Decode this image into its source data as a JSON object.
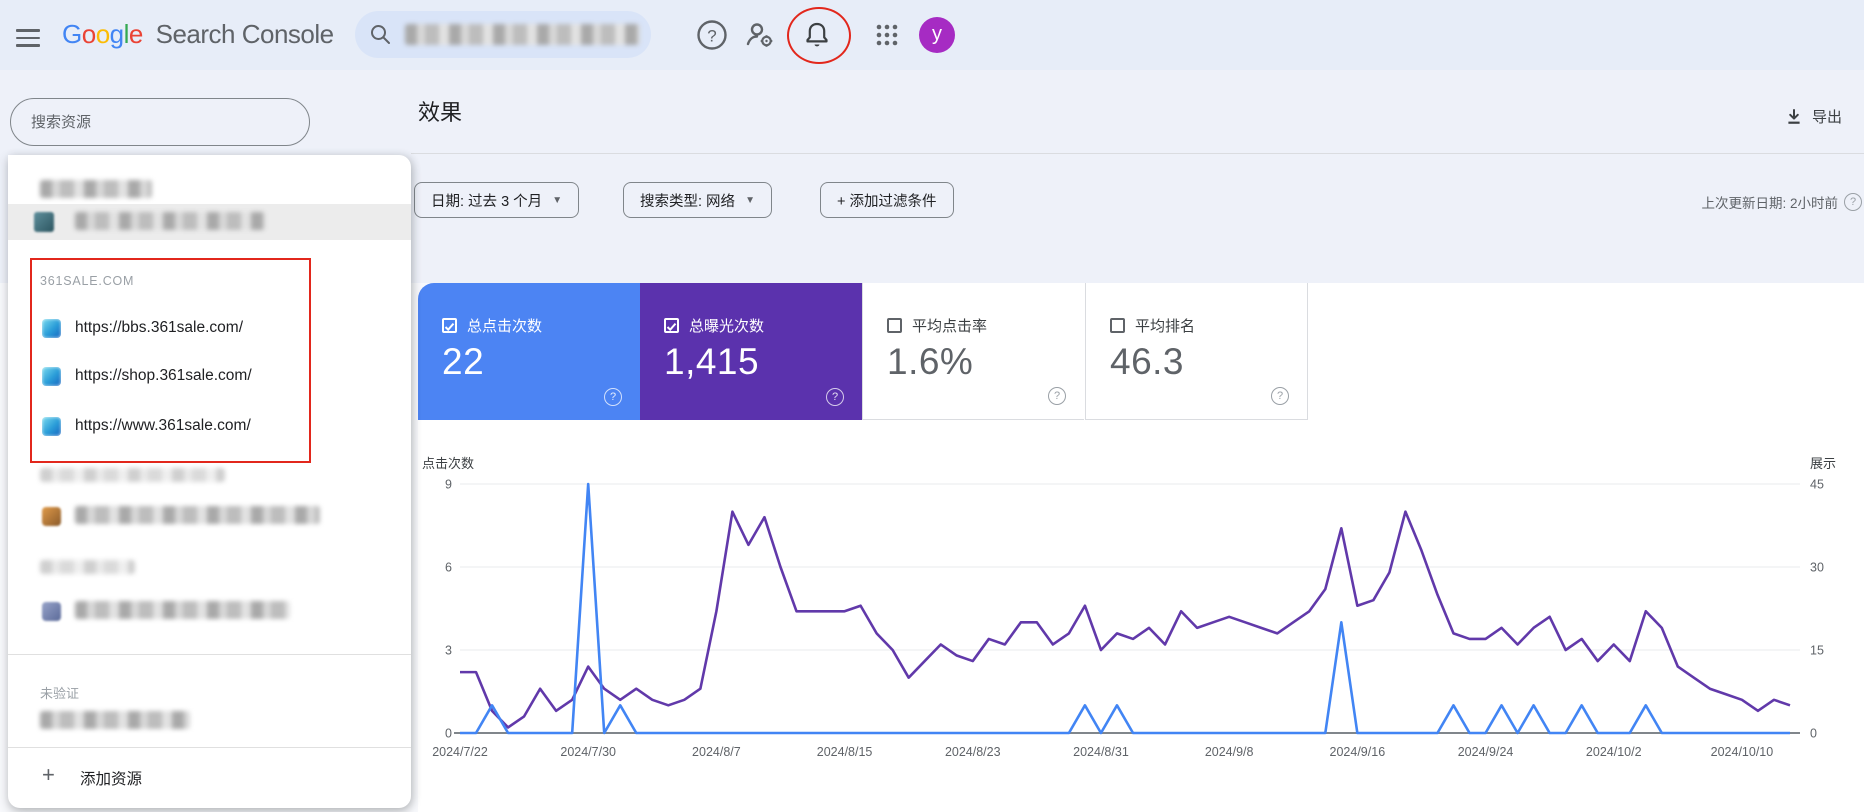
{
  "topbar": {
    "logo_google": "Google",
    "logo_letters": [
      "G",
      "o",
      "o",
      "g",
      "l",
      "e"
    ],
    "logo_colors": [
      "#4285F4",
      "#EA4335",
      "#FBBC05",
      "#4285F4",
      "#34A853",
      "#EA4335"
    ],
    "app_title": "Search Console",
    "avatar_letter": "y",
    "avatar_color": "#a62bc3",
    "annotation_color": "#e2271c"
  },
  "sidebar": {
    "search_placeholder": "搜索资源",
    "group_361sale": {
      "header": "361SALE.COM",
      "items": [
        "https://bbs.361sale.com/",
        "https://shop.361sale.com/",
        "https://www.361sale.com/"
      ]
    },
    "unverified_label": "未验证",
    "add_property_label": "添加资源",
    "add_property_plus": "+"
  },
  "header": {
    "title": "效果",
    "export_label": "导出",
    "filters": [
      {
        "label": "日期: 过去 3 个月",
        "dropdown": true
      },
      {
        "label": "搜索类型: 网络",
        "dropdown": true
      },
      {
        "label": "+ 添加过滤条件",
        "dropdown": false
      }
    ],
    "last_updated": "上次更新日期: 2小时前"
  },
  "metrics": {
    "cards": [
      {
        "label": "总点击次数",
        "value": "22",
        "checked": true,
        "color": "#4c84f3"
      },
      {
        "label": "总曝光次数",
        "value": "1,415",
        "checked": true,
        "color": "#5b32ad"
      },
      {
        "label": "平均点击率",
        "value": "1.6%",
        "checked": false,
        "color": "#ffffff"
      },
      {
        "label": "平均排名",
        "value": "46.3",
        "checked": false,
        "color": "#ffffff"
      }
    ]
  },
  "chart_data": {
    "type": "line",
    "title": "效果 - 点击次数与展示",
    "left_axis_label": "点击次数",
    "right_axis_label": "展示",
    "left_ticks": [
      0,
      3,
      6,
      9
    ],
    "right_ticks": [
      0,
      15,
      30,
      45
    ],
    "left_ylim": [
      0,
      9
    ],
    "right_ylim": [
      0,
      45
    ],
    "grid": true,
    "x_tick_labels": [
      "2024/7/22",
      "2024/7/30",
      "2024/8/7",
      "2024/8/15",
      "2024/8/23",
      "2024/8/31",
      "2024/9/8",
      "2024/9/16",
      "2024/9/24",
      "2024/10/2",
      "2024/10/10"
    ],
    "x_tick_indices": [
      0,
      8,
      16,
      24,
      32,
      40,
      48,
      56,
      64,
      72,
      80
    ],
    "dates": [
      "2024/7/22",
      "2024/7/23",
      "2024/7/24",
      "2024/7/25",
      "2024/7/26",
      "2024/7/27",
      "2024/7/28",
      "2024/7/29",
      "2024/7/30",
      "2024/7/31",
      "2024/8/1",
      "2024/8/2",
      "2024/8/3",
      "2024/8/4",
      "2024/8/5",
      "2024/8/6",
      "2024/8/7",
      "2024/8/8",
      "2024/8/9",
      "2024/8/10",
      "2024/8/11",
      "2024/8/12",
      "2024/8/13",
      "2024/8/14",
      "2024/8/15",
      "2024/8/16",
      "2024/8/17",
      "2024/8/18",
      "2024/8/19",
      "2024/8/20",
      "2024/8/21",
      "2024/8/22",
      "2024/8/23",
      "2024/8/24",
      "2024/8/25",
      "2024/8/26",
      "2024/8/27",
      "2024/8/28",
      "2024/8/29",
      "2024/8/30",
      "2024/8/31",
      "2024/9/1",
      "2024/9/2",
      "2024/9/3",
      "2024/9/4",
      "2024/9/5",
      "2024/9/6",
      "2024/9/7",
      "2024/9/8",
      "2024/9/9",
      "2024/9/10",
      "2024/9/11",
      "2024/9/12",
      "2024/9/13",
      "2024/9/14",
      "2024/9/15",
      "2024/9/16",
      "2024/9/17",
      "2024/9/18",
      "2024/9/19",
      "2024/9/20",
      "2024/9/21",
      "2024/9/22",
      "2024/9/23",
      "2024/9/24",
      "2024/9/25",
      "2024/9/26",
      "2024/9/27",
      "2024/9/28",
      "2024/9/29",
      "2024/9/30",
      "2024/10/1",
      "2024/10/2",
      "2024/10/3",
      "2024/10/4",
      "2024/10/5",
      "2024/10/6",
      "2024/10/7",
      "2024/10/8",
      "2024/10/9",
      "2024/10/10",
      "2024/10/11",
      "2024/10/12",
      "2024/10/13"
    ],
    "series": [
      {
        "name": "总点击次数",
        "axis": "left",
        "color": "#4285f4",
        "total": 22,
        "values": [
          0,
          0,
          1,
          0,
          0,
          0,
          0,
          0,
          9,
          0,
          1,
          0,
          0,
          0,
          0,
          0,
          0,
          0,
          0,
          0,
          0,
          0,
          0,
          0,
          0,
          0,
          0,
          0,
          0,
          0,
          0,
          0,
          0,
          0,
          0,
          0,
          0,
          0,
          0,
          1,
          0,
          1,
          0,
          0,
          0,
          0,
          0,
          0,
          0,
          0,
          0,
          0,
          0,
          0,
          0,
          4,
          0,
          0,
          0,
          0,
          0,
          0,
          1,
          0,
          0,
          1,
          0,
          1,
          0,
          0,
          1,
          0,
          0,
          0,
          1,
          0,
          0,
          0,
          0,
          0,
          0,
          0,
          0,
          0
        ]
      },
      {
        "name": "总曝光次数",
        "axis": "right",
        "color": "#6139aa",
        "total": 1415,
        "values": [
          11,
          11,
          4,
          1,
          3,
          8,
          4,
          6,
          12,
          8,
          6,
          8,
          6,
          5,
          6,
          8,
          22,
          40,
          34,
          39,
          30,
          22,
          22,
          22,
          22,
          23,
          18,
          15,
          10,
          13,
          16,
          14,
          13,
          17,
          16,
          20,
          20,
          16,
          18,
          23,
          15,
          18,
          17,
          19,
          16,
          22,
          19,
          20,
          21,
          20,
          19,
          18,
          20,
          22,
          26,
          37,
          23,
          24,
          29,
          40,
          33,
          25,
          18,
          17,
          17,
          19,
          16,
          19,
          21,
          15,
          17,
          13,
          16,
          13,
          22,
          19,
          12,
          10,
          8,
          7,
          6,
          4,
          6,
          5
        ]
      }
    ]
  }
}
